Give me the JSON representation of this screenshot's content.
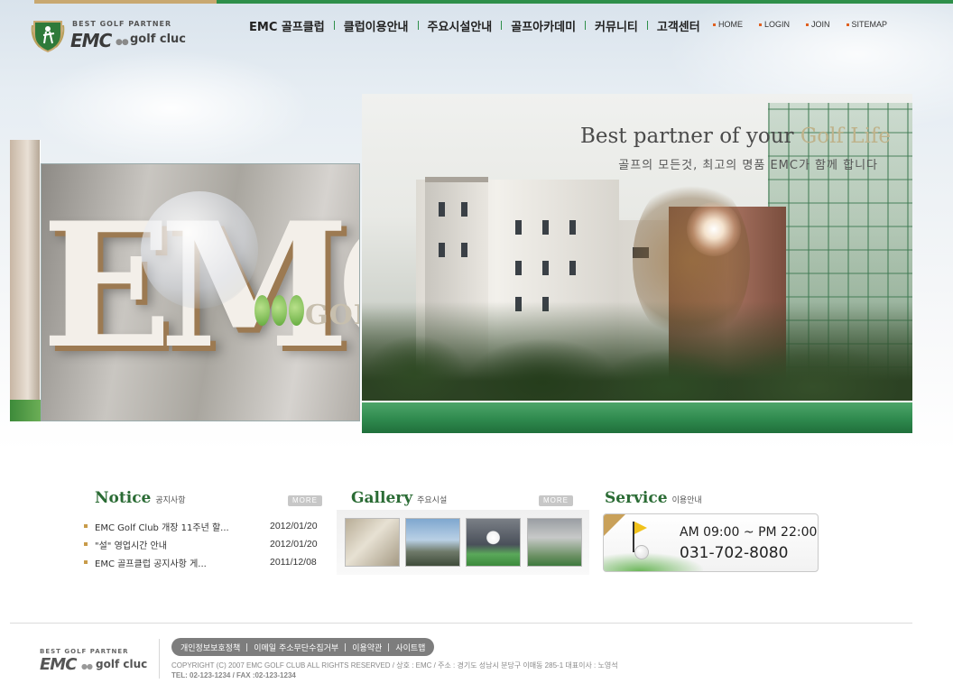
{
  "logo": {
    "tagline": "BEST GOLF PARTNER",
    "brand": "EMC",
    "dots": "●●",
    "sub": "golf cluc"
  },
  "gnb": [
    {
      "label": "EMC 골프클럽"
    },
    {
      "label": "클럽이용안내"
    },
    {
      "label": "주요시설안내"
    },
    {
      "label": "골프아카데미"
    },
    {
      "label": "커뮤니티"
    },
    {
      "label": "고객센터"
    }
  ],
  "util": [
    {
      "label": "HOME"
    },
    {
      "label": "LOGIN"
    },
    {
      "label": "JOIN"
    },
    {
      "label": "SITEMAP"
    }
  ],
  "visual": {
    "sign_text": "EMC",
    "sign_golf": "GOLF",
    "headline_part1": "Best partner of your ",
    "headline_part2": "Golf Life",
    "subline": "골프의 모든것, 최고의 명품 EMC가 함께 합니다"
  },
  "notice": {
    "title": "Notice",
    "title_ko": "공지사항",
    "more": "MORE",
    "items": [
      {
        "title": "EMC Golf Club 개장 11주년 할...",
        "date": "2012/01/20"
      },
      {
        "title": "\"설\" 영업시간 안내",
        "date": "2012/01/20"
      },
      {
        "title": "EMC 골프클럽 공지사항 게...",
        "date": "2011/12/08"
      }
    ]
  },
  "gallery": {
    "title": "Gallery",
    "title_ko": "주요시설",
    "more": "MORE"
  },
  "service": {
    "title": "Service",
    "title_ko": "이용안내",
    "hours": "AM 09:00 ~ PM 22:00",
    "tel": "031-702-8080"
  },
  "footer": {
    "logo_tagline": "BEST GOLF PARTNER",
    "logo_brand": "EMC",
    "logo_dots": "●●",
    "logo_sub": "golf cluc",
    "menu": [
      {
        "label": "개인정보보호정책"
      },
      {
        "label": "이메일 주소무단수집거부"
      },
      {
        "label": "이용약관"
      },
      {
        "label": "사이트맵"
      }
    ],
    "copyright": "COPYRIGHT (C) 2007 EMC GOLF CLUB ALL RIGHTS RESERVED / 상호 : EMC / 주소 : 경기도 성남시 분당구 이매동 285-1  대표이사 : 노영석",
    "telfax": "TEL: 02-123-1234 / FAX :02-123-1234"
  },
  "colors": {
    "accent_green": "#2e8f4a",
    "title_green": "#2a6b34",
    "gold": "#c8a870"
  }
}
